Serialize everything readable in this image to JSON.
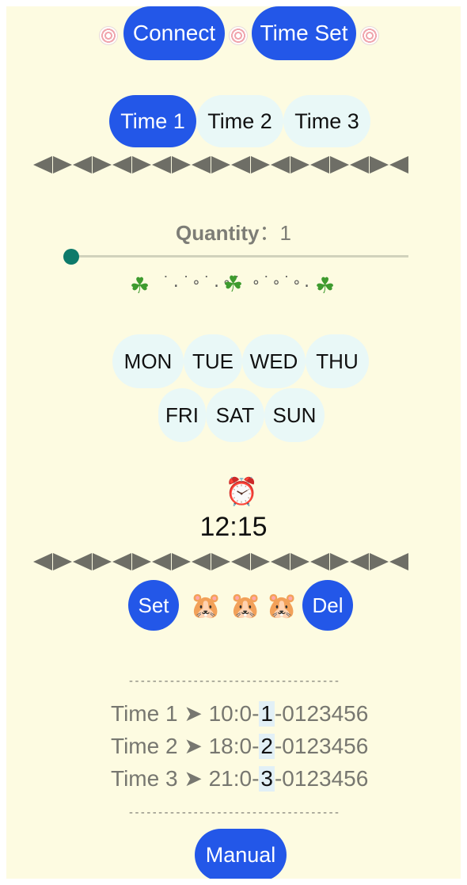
{
  "header": {
    "connect_label": "Connect",
    "time_set_label": "Time Set",
    "decor_icon": "swirl-candy-icon"
  },
  "time_tabs": {
    "selected": "Time 1",
    "items": [
      {
        "label": "Time 1"
      },
      {
        "label": "Time 2"
      },
      {
        "label": "Time 3"
      }
    ]
  },
  "quantity": {
    "label": "Quantity",
    "separator": "：",
    "value": "1",
    "slider_fraction": 0.0
  },
  "decor_clovers": {
    "icon": "clover-icon",
    "dots_left": "˙.˙∘˙.∘˙",
    "dots_right": "∘˙∘˙∘."
  },
  "days": {
    "row1": [
      {
        "label": "MON"
      },
      {
        "label": "TUE"
      },
      {
        "label": "WED"
      },
      {
        "label": "THU"
      }
    ],
    "row2": [
      {
        "label": "FRI"
      },
      {
        "label": "SAT"
      },
      {
        "label": "SUN"
      }
    ]
  },
  "clock": {
    "icon": "alarm-clock-icon",
    "time": "12:15"
  },
  "actions": {
    "set_label": "Set",
    "del_label": "Del",
    "decor_icon": "hamster-icon"
  },
  "divider_text": "------------------------------------",
  "schedule": [
    {
      "name": "Time 1",
      "arrow": "➤",
      "prefix": "10:0-",
      "qty": "1",
      "suffix": "-0123456"
    },
    {
      "name": "Time 2",
      "arrow": "➤",
      "prefix": "18:0-",
      "qty": "2",
      "suffix": "-0123456"
    },
    {
      "name": "Time 3",
      "arrow": "➤",
      "prefix": "21:0-",
      "qty": "3",
      "suffix": "-0123456"
    }
  ],
  "manual_label": "Manual",
  "colors": {
    "background": "#fdfbe1",
    "accent_blue": "#2357e8",
    "pill_light": "#e9f8f7",
    "slider_thumb": "#0d7a6a",
    "triangle": "#6e6e66"
  }
}
